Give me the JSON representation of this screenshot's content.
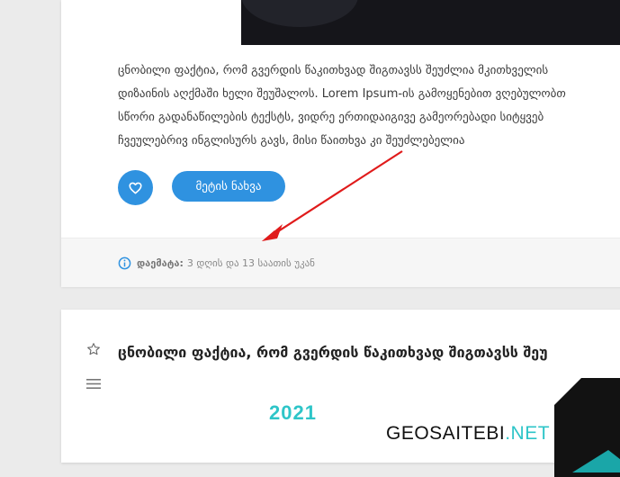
{
  "post1": {
    "excerpt_lines": [
      "ცნობილი ფაქტია, რომ გვერდის წაკითხვად შიგთავსს შეუძლია მკითხველის",
      "დიზაინის აღქმაში ხელი შეუშალოს. Lorem Ipsum-ის გამოყენებით ვღებულობთ",
      "სწორი გადანაწილების ტექსტს, ვიდრე ერთიდაიგივე გამეორებადი სიტყვებ",
      "ჩვეულებრივ ინგლისურს გავს, მისი წაითხვა კი შეუძლებელია"
    ],
    "like_icon": "heart-icon",
    "more_label": "მეტის ნახვა",
    "meta_icon": "info-icon",
    "meta_label": "დაემატა:",
    "meta_value": "3 დღის და 13 საათის უკან"
  },
  "post2": {
    "star_icon": "star-icon",
    "menu_icon": "menu-icon",
    "title": "ცნობილი ფაქტია, რომ გვერდის წაკითხვად შიგთავსს შეუ",
    "banner_year": "2021",
    "brand_main": "GEOSAITEBI",
    "brand_suffix": ".NET"
  },
  "colors": {
    "accent": "#2f92e0",
    "teal": "#2ec5c8",
    "arrow": "#e01b1b"
  }
}
